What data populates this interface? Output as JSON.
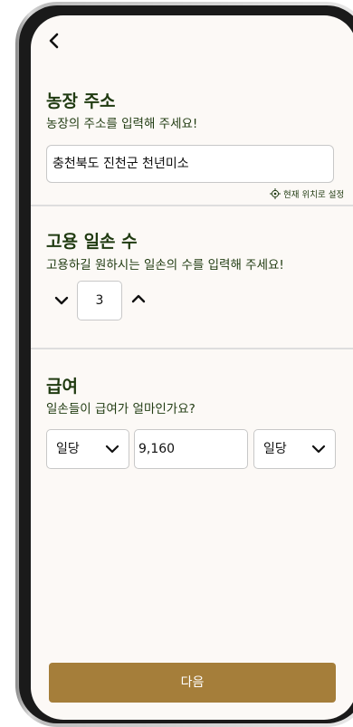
{
  "address": {
    "title": "농장 주소",
    "subtitle": "농장의 주소를 입력해 주세요!",
    "value": "충천북도 진천군 천년미소",
    "locate_label": "현재 위치로 설정"
  },
  "workers": {
    "title": "고용 일손 수",
    "subtitle": "고용하길 원하시는 일손의 수를 입력해 주세요!",
    "count": "3"
  },
  "wage": {
    "title": "급여",
    "subtitle": "일손들이 급여가 얼마인가요?",
    "unit_left": "일당",
    "amount": "9,160",
    "unit_right": "일당"
  },
  "footer": {
    "next_label": "다음"
  },
  "colors": {
    "primary_text": "#1f3a10",
    "accent_button": "#a57e3a",
    "screen_background": "#fcf9f6"
  },
  "icons": {
    "back": "chevron-left-icon",
    "locate": "crosshair-icon",
    "decrement": "chevron-down-icon",
    "increment": "chevron-up-icon",
    "dropdown": "chevron-down-icon"
  }
}
